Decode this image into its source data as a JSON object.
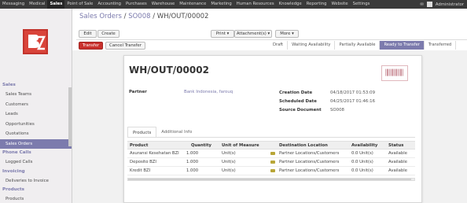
{
  "topmenu": [
    "Messaging",
    "Medical",
    "Sales",
    "Point of Sale",
    "Accounting",
    "Purchases",
    "Warehouse",
    "Maintenance",
    "Marketing",
    "Human Resources",
    "Knowledge",
    "Reporting",
    "Website",
    "Settings"
  ],
  "topmenu_active": "Sales",
  "user": "Administrator",
  "breadcrumb": {
    "part1": "Sales Orders",
    "part2": "SO008",
    "current": "WH/OUT/00002",
    "sep": " / "
  },
  "toolbar": {
    "edit": "Edit",
    "create": "Create",
    "print": "Print ▾",
    "attachments": "Attachment(s) ▾",
    "more": "More ▾"
  },
  "actions": {
    "transfer": "Transfer",
    "cancel": "Cancel Transfer"
  },
  "stages": [
    "Draft",
    "Waiting Availability",
    "Partially Available",
    "Ready to Transfer",
    "Transferred"
  ],
  "active_stage": "Ready to Transfer",
  "sidebar": [
    {
      "type": "sec",
      "label": "Sales"
    },
    {
      "type": "item",
      "label": "Sales Teams"
    },
    {
      "type": "item",
      "label": "Customers"
    },
    {
      "type": "item",
      "label": "Leads"
    },
    {
      "type": "item",
      "label": "Opportunities"
    },
    {
      "type": "item",
      "label": "Quotations"
    },
    {
      "type": "item",
      "label": "Sales Orders",
      "active": true
    },
    {
      "type": "sec",
      "label": "Phone Calls"
    },
    {
      "type": "item",
      "label": "Logged Calls"
    },
    {
      "type": "sec",
      "label": "Invoicing"
    },
    {
      "type": "item",
      "label": "Deliveries to Invoice"
    },
    {
      "type": "sec",
      "label": "Products"
    },
    {
      "type": "item",
      "label": "Products"
    }
  ],
  "form": {
    "title": "WH/OUT/00002",
    "partner_label": "Partner",
    "partner_value": "Bank Indonesia, farouq",
    "creation_label": "Creation Date",
    "creation_value": "04/18/2017 01:53:09",
    "scheduled_label": "Scheduled Date",
    "scheduled_value": "04/25/2017 01:46:16",
    "source_label": "Source Document",
    "source_value": "SO008"
  },
  "tabs": [
    "Products",
    "Additional Info"
  ],
  "table": {
    "headers": [
      "Product",
      "Quantity",
      "Unit of Measure",
      "Destination Location",
      "Availability",
      "Status"
    ],
    "rows": [
      [
        "Asuransi Kesehatan BZI",
        "1.000",
        "Unit(s)",
        "Partner Locations/Customers",
        "0.0 Unit(s)",
        "Available"
      ],
      [
        "Deposito BZI",
        "1.000",
        "Unit(s)",
        "Partner Locations/Customers",
        "0.0 Unit(s)",
        "Available"
      ],
      [
        "Kredit BZI",
        "1.000",
        "Unit(s)",
        "Partner Locations/Customers",
        "0.0 Unit(s)",
        "Available"
      ]
    ]
  },
  "colors": {
    "accent": "#7c7bad",
    "primary_button": "#c9302c",
    "topbar": "#3a3a3a"
  }
}
